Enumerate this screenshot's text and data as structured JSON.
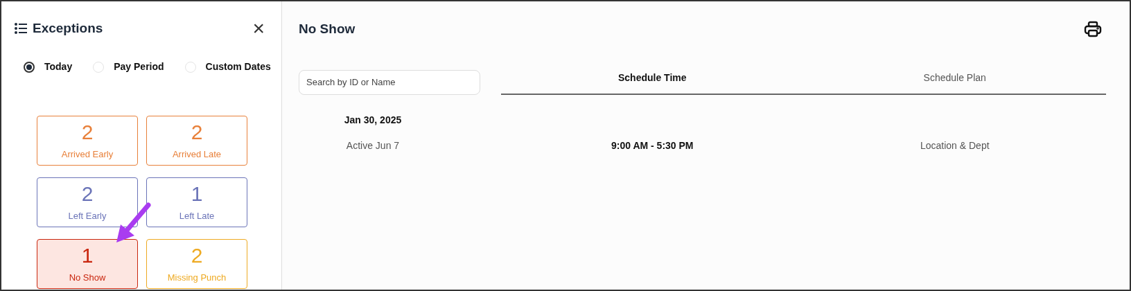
{
  "sidebar": {
    "title": "Exceptions",
    "close": "×",
    "ranges": [
      {
        "label": "Today",
        "selected": true
      },
      {
        "label": "Pay Period",
        "selected": false
      },
      {
        "label": "Custom Dates",
        "selected": false
      }
    ],
    "cards": [
      {
        "count": "2",
        "label": "Arrived Early",
        "color": "#e8803a",
        "selected": false
      },
      {
        "count": "2",
        "label": "Arrived Late",
        "color": "#e8803a",
        "selected": false
      },
      {
        "count": "2",
        "label": "Left Early",
        "color": "#6b74b8",
        "selected": false
      },
      {
        "count": "1",
        "label": "Left Late",
        "color": "#6b74b8",
        "selected": false
      },
      {
        "count": "1",
        "label": "No Show",
        "color": "#c9260e",
        "selected": true
      },
      {
        "count": "2",
        "label": "Missing Punch",
        "color": "#eeaa22",
        "selected": false
      }
    ]
  },
  "main": {
    "title": "No Show",
    "search": {
      "placeholder": "Search by ID or Name"
    },
    "tabs": [
      {
        "label": "Schedule Time",
        "selected": true
      },
      {
        "label": "Schedule Plan",
        "selected": false
      }
    ],
    "groups": [
      {
        "date": "Jan 30, 2025",
        "rows": [
          {
            "name": "Active Jun 7",
            "time": "9:00 AM - 5:30 PM",
            "plan": "Location & Dept"
          }
        ]
      }
    ]
  }
}
